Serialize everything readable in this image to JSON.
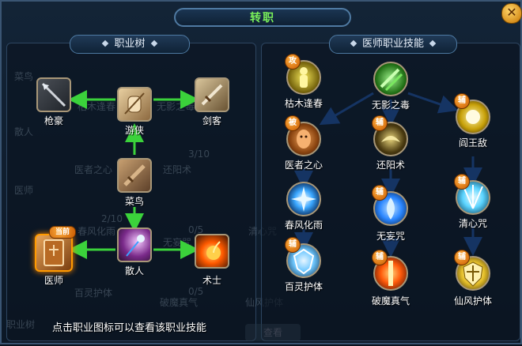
{
  "title": "转职",
  "left_panel": {
    "header": "职业树",
    "nodes": [
      {
        "id": "qianghao",
        "label": "枪豪",
        "icon": "spear-icon",
        "color": "#8a8f96"
      },
      {
        "id": "youxia",
        "label": "游侠",
        "icon": "fist-icon",
        "color": "#c9a676"
      },
      {
        "id": "jianke",
        "label": "剑客",
        "icon": "sword-icon",
        "color": "#b8a27a"
      },
      {
        "id": "cainiao",
        "label": "菜鸟",
        "icon": "wooden-sword-icon",
        "color": "#9f7b58"
      },
      {
        "id": "sanren",
        "label": "散人",
        "icon": "wand-icon",
        "color": "#b35ab8"
      },
      {
        "id": "yishi",
        "label": "医师",
        "icon": "book-icon",
        "color": "#c07a32",
        "badge": "当前",
        "selected": true
      },
      {
        "id": "shushi",
        "label": "术士",
        "icon": "fireball-icon",
        "color": "#ff6a1a"
      }
    ],
    "ghost_texts": [
      "菜鸟",
      "散人",
      "医师",
      "枯木逢春",
      "无影之毒",
      "医者之心",
      "还阳术",
      "春风化雨",
      "无妄咒",
      "清心咒",
      "百灵护体",
      "破魔真气",
      "仙风护体",
      "职业树",
      "3/10",
      "2/10",
      "0/5",
      "0/5"
    ]
  },
  "right_panel": {
    "header": "医师职业技能",
    "skills": [
      {
        "id": "kumu",
        "label": "枯木逢春",
        "badge": "攻",
        "icon": "healing-figure-icon",
        "color": "#c7b51a"
      },
      {
        "id": "wuying",
        "label": "无影之毒",
        "badge": "",
        "icon": "poison-slash-icon",
        "color": "#3ca52a"
      },
      {
        "id": "yanwangdi",
        "label": "阎王敌",
        "badge": "辅",
        "icon": "golden-orb-icon",
        "color": "#e7c92a"
      },
      {
        "id": "yizhe",
        "label": "医者之心",
        "badge": "被",
        "icon": "monk-face-icon",
        "color": "#e0893a"
      },
      {
        "id": "huanyang",
        "label": "还阳术",
        "badge": "辅",
        "icon": "bird-spirit-icon",
        "color": "#d8c15a"
      },
      {
        "id": "chunfeng",
        "label": "春风化雨",
        "badge": "辅",
        "icon": "burst-icon",
        "color": "#3aa7ff"
      },
      {
        "id": "wuwang",
        "label": "无妄咒",
        "badge": "辅",
        "icon": "blue-flame-icon",
        "color": "#2a86ff"
      },
      {
        "id": "qingxin",
        "label": "清心咒",
        "badge": "辅",
        "icon": "light-rays-icon",
        "color": "#5bd4ff"
      },
      {
        "id": "bailing",
        "label": "百灵护体",
        "badge": "辅",
        "icon": "crystal-shield-icon",
        "color": "#6fc8ff"
      },
      {
        "id": "pomo",
        "label": "破魔真气",
        "badge": "辅",
        "icon": "fire-pillar-icon",
        "color": "#ff6a1a"
      },
      {
        "id": "xianfeng",
        "label": "仙风护体",
        "badge": "辅",
        "icon": "golden-shield-icon",
        "color": "#e6c02a"
      }
    ]
  },
  "hint": "点击职业图标可以查看该职业技能",
  "buttons": {
    "confirm": "查看"
  },
  "colors": {
    "accent": "#79f05a",
    "arrow_green": "#3bd23b",
    "arrow_blue": "#2a6fe0",
    "badge": "#e07a1a"
  }
}
